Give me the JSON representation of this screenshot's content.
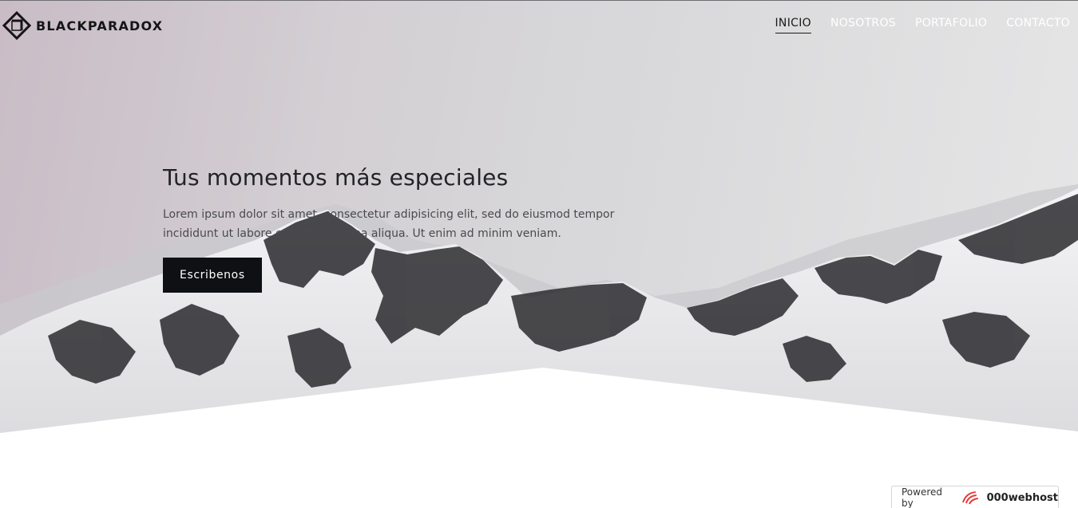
{
  "header": {
    "logo_text": "BLACKPARADOX",
    "nav": [
      {
        "label": "INICIO",
        "active": true
      },
      {
        "label": "NOSOTROS",
        "active": false
      },
      {
        "label": "PORTAFOLIO",
        "active": false
      },
      {
        "label": "CONTACTO",
        "active": false
      }
    ]
  },
  "hero": {
    "title": "Tus momentos más especiales",
    "text": "Lorem ipsum dolor sit amet, consectetur adipisicing elit, sed do eiusmod tempor incididunt ut labore et dolore magna aliqua. Ut enim ad minim veniam.",
    "cta_label": "Escribenos"
  },
  "footer_badge": {
    "powered_by": "Powered by",
    "brand": "000webhost",
    "brand_color": "#e53935"
  },
  "colors": {
    "button_bg": "#0e1013",
    "nav_active": "#1a1a1a",
    "nav_inactive": "#ffffff"
  }
}
